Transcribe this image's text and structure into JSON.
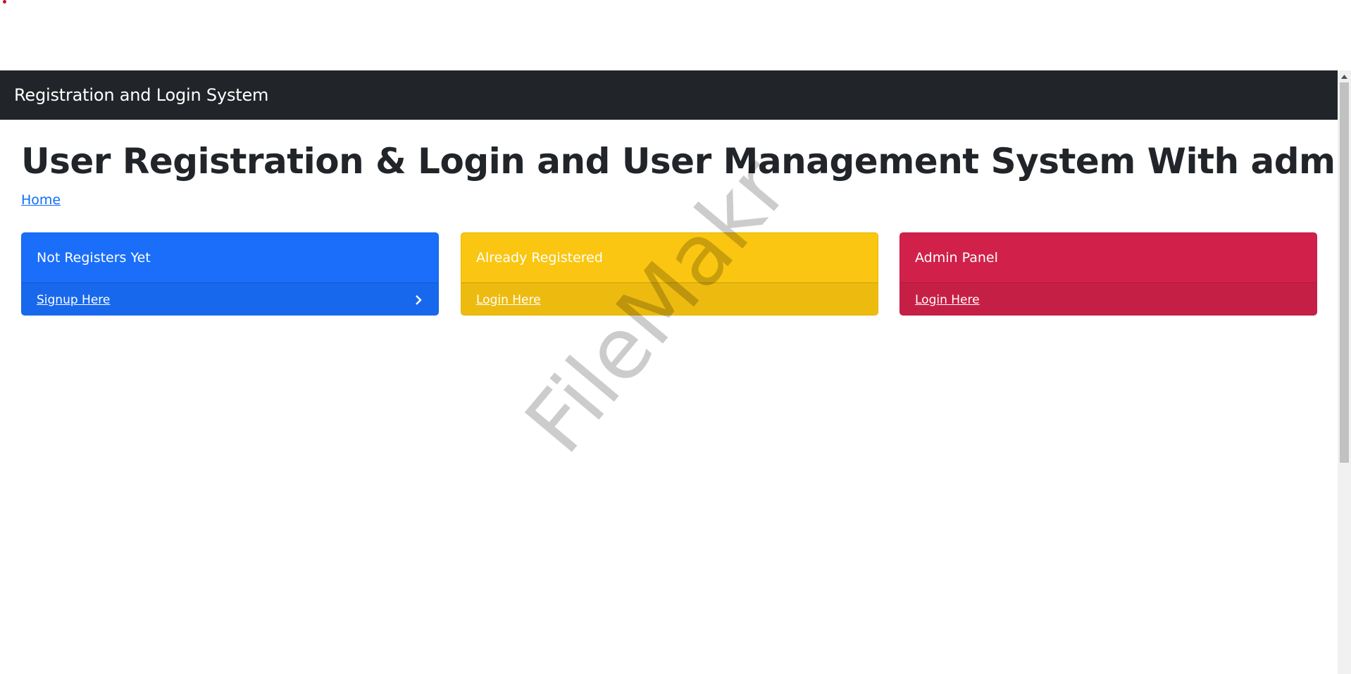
{
  "navbar": {
    "brand": "Registration and Login System"
  },
  "main": {
    "title": "User Registration & Login and User Management System With admin panel",
    "breadcrumb_home": "Home"
  },
  "cards": [
    {
      "title": "Not Registers Yet",
      "link": "Signup Here",
      "color": "#1a6efa"
    },
    {
      "title": "Already Registered",
      "link": "Login Here",
      "color": "#fac611"
    },
    {
      "title": "Admin Panel",
      "link": "Login Here",
      "color": "#d1214a"
    }
  ],
  "watermark": "FileMakr",
  "icons": {
    "card_footer_arrow": "chevron-right-icon",
    "scroll_up": "triangle-up-icon"
  }
}
